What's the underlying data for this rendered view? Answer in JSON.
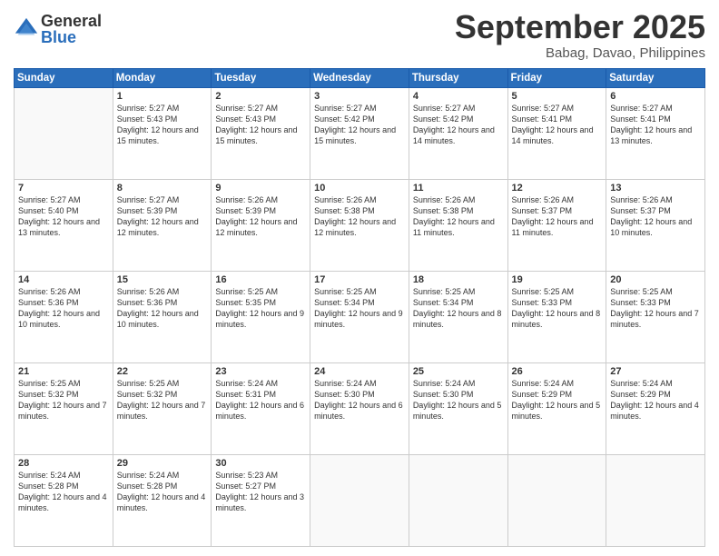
{
  "logo": {
    "general": "General",
    "blue": "Blue"
  },
  "header": {
    "month": "September 2025",
    "location": "Babag, Davao, Philippines"
  },
  "days_of_week": [
    "Sunday",
    "Monday",
    "Tuesday",
    "Wednesday",
    "Thursday",
    "Friday",
    "Saturday"
  ],
  "weeks": [
    [
      {
        "day": "",
        "sunrise": "",
        "sunset": "",
        "daylight": ""
      },
      {
        "day": "1",
        "sunrise": "Sunrise: 5:27 AM",
        "sunset": "Sunset: 5:43 PM",
        "daylight": "Daylight: 12 hours and 15 minutes."
      },
      {
        "day": "2",
        "sunrise": "Sunrise: 5:27 AM",
        "sunset": "Sunset: 5:43 PM",
        "daylight": "Daylight: 12 hours and 15 minutes."
      },
      {
        "day": "3",
        "sunrise": "Sunrise: 5:27 AM",
        "sunset": "Sunset: 5:42 PM",
        "daylight": "Daylight: 12 hours and 15 minutes."
      },
      {
        "day": "4",
        "sunrise": "Sunrise: 5:27 AM",
        "sunset": "Sunset: 5:42 PM",
        "daylight": "Daylight: 12 hours and 14 minutes."
      },
      {
        "day": "5",
        "sunrise": "Sunrise: 5:27 AM",
        "sunset": "Sunset: 5:41 PM",
        "daylight": "Daylight: 12 hours and 14 minutes."
      },
      {
        "day": "6",
        "sunrise": "Sunrise: 5:27 AM",
        "sunset": "Sunset: 5:41 PM",
        "daylight": "Daylight: 12 hours and 13 minutes."
      }
    ],
    [
      {
        "day": "7",
        "sunrise": "Sunrise: 5:27 AM",
        "sunset": "Sunset: 5:40 PM",
        "daylight": "Daylight: 12 hours and 13 minutes."
      },
      {
        "day": "8",
        "sunrise": "Sunrise: 5:27 AM",
        "sunset": "Sunset: 5:39 PM",
        "daylight": "Daylight: 12 hours and 12 minutes."
      },
      {
        "day": "9",
        "sunrise": "Sunrise: 5:26 AM",
        "sunset": "Sunset: 5:39 PM",
        "daylight": "Daylight: 12 hours and 12 minutes."
      },
      {
        "day": "10",
        "sunrise": "Sunrise: 5:26 AM",
        "sunset": "Sunset: 5:38 PM",
        "daylight": "Daylight: 12 hours and 12 minutes."
      },
      {
        "day": "11",
        "sunrise": "Sunrise: 5:26 AM",
        "sunset": "Sunset: 5:38 PM",
        "daylight": "Daylight: 12 hours and 11 minutes."
      },
      {
        "day": "12",
        "sunrise": "Sunrise: 5:26 AM",
        "sunset": "Sunset: 5:37 PM",
        "daylight": "Daylight: 12 hours and 11 minutes."
      },
      {
        "day": "13",
        "sunrise": "Sunrise: 5:26 AM",
        "sunset": "Sunset: 5:37 PM",
        "daylight": "Daylight: 12 hours and 10 minutes."
      }
    ],
    [
      {
        "day": "14",
        "sunrise": "Sunrise: 5:26 AM",
        "sunset": "Sunset: 5:36 PM",
        "daylight": "Daylight: 12 hours and 10 minutes."
      },
      {
        "day": "15",
        "sunrise": "Sunrise: 5:26 AM",
        "sunset": "Sunset: 5:36 PM",
        "daylight": "Daylight: 12 hours and 10 minutes."
      },
      {
        "day": "16",
        "sunrise": "Sunrise: 5:25 AM",
        "sunset": "Sunset: 5:35 PM",
        "daylight": "Daylight: 12 hours and 9 minutes."
      },
      {
        "day": "17",
        "sunrise": "Sunrise: 5:25 AM",
        "sunset": "Sunset: 5:34 PM",
        "daylight": "Daylight: 12 hours and 9 minutes."
      },
      {
        "day": "18",
        "sunrise": "Sunrise: 5:25 AM",
        "sunset": "Sunset: 5:34 PM",
        "daylight": "Daylight: 12 hours and 8 minutes."
      },
      {
        "day": "19",
        "sunrise": "Sunrise: 5:25 AM",
        "sunset": "Sunset: 5:33 PM",
        "daylight": "Daylight: 12 hours and 8 minutes."
      },
      {
        "day": "20",
        "sunrise": "Sunrise: 5:25 AM",
        "sunset": "Sunset: 5:33 PM",
        "daylight": "Daylight: 12 hours and 7 minutes."
      }
    ],
    [
      {
        "day": "21",
        "sunrise": "Sunrise: 5:25 AM",
        "sunset": "Sunset: 5:32 PM",
        "daylight": "Daylight: 12 hours and 7 minutes."
      },
      {
        "day": "22",
        "sunrise": "Sunrise: 5:25 AM",
        "sunset": "Sunset: 5:32 PM",
        "daylight": "Daylight: 12 hours and 7 minutes."
      },
      {
        "day": "23",
        "sunrise": "Sunrise: 5:24 AM",
        "sunset": "Sunset: 5:31 PM",
        "daylight": "Daylight: 12 hours and 6 minutes."
      },
      {
        "day": "24",
        "sunrise": "Sunrise: 5:24 AM",
        "sunset": "Sunset: 5:30 PM",
        "daylight": "Daylight: 12 hours and 6 minutes."
      },
      {
        "day": "25",
        "sunrise": "Sunrise: 5:24 AM",
        "sunset": "Sunset: 5:30 PM",
        "daylight": "Daylight: 12 hours and 5 minutes."
      },
      {
        "day": "26",
        "sunrise": "Sunrise: 5:24 AM",
        "sunset": "Sunset: 5:29 PM",
        "daylight": "Daylight: 12 hours and 5 minutes."
      },
      {
        "day": "27",
        "sunrise": "Sunrise: 5:24 AM",
        "sunset": "Sunset: 5:29 PM",
        "daylight": "Daylight: 12 hours and 4 minutes."
      }
    ],
    [
      {
        "day": "28",
        "sunrise": "Sunrise: 5:24 AM",
        "sunset": "Sunset: 5:28 PM",
        "daylight": "Daylight: 12 hours and 4 minutes."
      },
      {
        "day": "29",
        "sunrise": "Sunrise: 5:24 AM",
        "sunset": "Sunset: 5:28 PM",
        "daylight": "Daylight: 12 hours and 4 minutes."
      },
      {
        "day": "30",
        "sunrise": "Sunrise: 5:23 AM",
        "sunset": "Sunset: 5:27 PM",
        "daylight": "Daylight: 12 hours and 3 minutes."
      },
      {
        "day": "",
        "sunrise": "",
        "sunset": "",
        "daylight": ""
      },
      {
        "day": "",
        "sunrise": "",
        "sunset": "",
        "daylight": ""
      },
      {
        "day": "",
        "sunrise": "",
        "sunset": "",
        "daylight": ""
      },
      {
        "day": "",
        "sunrise": "",
        "sunset": "",
        "daylight": ""
      }
    ]
  ]
}
